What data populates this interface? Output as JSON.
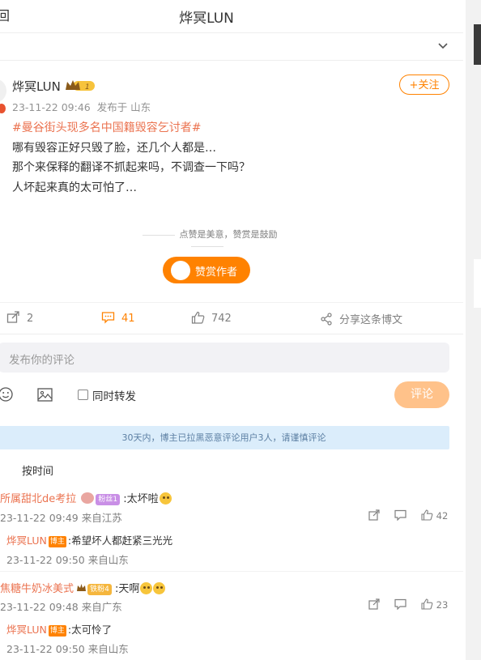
{
  "header": {
    "back_label": "回",
    "title": "烨冥LUN"
  },
  "post": {
    "author": "烨冥LUN",
    "level_badge": "1",
    "timestamp": "23-11-22 09:46",
    "location": "发布于 山东",
    "follow_label": "+关注",
    "hashtag": "#曼谷街头现多名中国籍毁容乞讨者#",
    "lines": [
      "哪有毁容正好只毁了脸，还几个人都是…",
      "那个来保释的翻译不抓起来吗，不调查一下吗？",
      "人坏起来真的太可怕了…"
    ],
    "reward_hint": "点赞是美意，赞赏是鼓励",
    "reward_button": "赞赏作者"
  },
  "actions": {
    "repost_count": "2",
    "comment_count": "41",
    "like_count": "742",
    "share_label": "分享这条博文"
  },
  "composer": {
    "placeholder": "发布你的评论",
    "repost_label": "同时转发",
    "submit_label": "评论"
  },
  "notice": "30天内，博主已拉黑恶意评论用户3人，请谨慎评论",
  "sort_label": "按时间",
  "comments": [
    {
      "user": "所属甜北de考拉",
      "fan_badge": "粉丝1",
      "text": ":太坏啦",
      "time": "23-11-22 09:49 来自江苏",
      "likes": "42",
      "reply": {
        "user": "烨冥LUN",
        "badge": "博主",
        "text": ":希望坏人都赶紧三光光",
        "time": "23-11-22 09:50 来自山东"
      }
    },
    {
      "user": "焦糖牛奶冰美式",
      "fan_badge": "铁粉4",
      "text": ":天啊",
      "time": "23-11-22 09:48 来自广东",
      "likes": "23",
      "reply": {
        "user": "烨冥LUN",
        "badge": "博主",
        "text": ":太可怜了",
        "time": "23-11-22 09:50 来自山东"
      }
    }
  ],
  "colors": {
    "accent": "#ff8200",
    "link": "#eb7350",
    "notice_bg": "#dbedfb"
  }
}
